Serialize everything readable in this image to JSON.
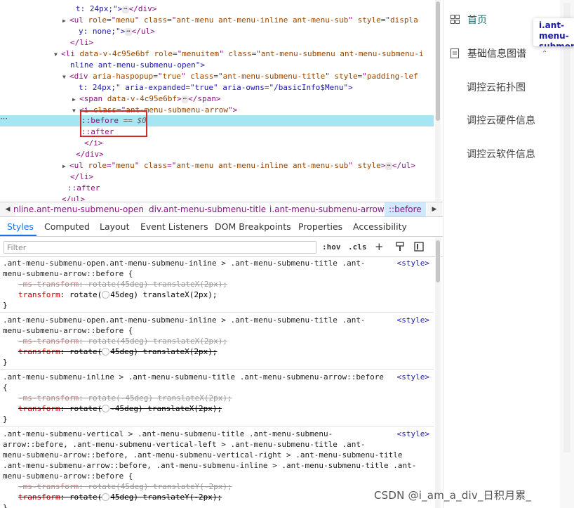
{
  "elements": {
    "lines": [
      {
        "pre": "      t: 24px;\">",
        "ell": true,
        "post": "</div>"
      },
      {
        "pre": "    <ul role=\"menu\" class=\"ant-menu ant-menu-inline ant-menu-sub\" style=\"displa"
      },
      {
        "pre": "      y: none;\">",
        "ell": true,
        "post": "</ul>"
      },
      {
        "pre": "    </li>"
      },
      {
        "pre": "  <li data-v-4c95e6bf role=\"menuitem\" class=\"ant-menu-submenu ant-menu-submenu-i"
      },
      {
        "pre": "    nline ant-menu-submenu-open\">"
      },
      {
        "pre": "    <div aria-haspopup=\"true\" class=\"ant-menu-submenu-title\" style=\"padding-lef"
      },
      {
        "pre": "      t: 24px;\" aria-expanded=\"true\" aria-owns=\"/basicInfo$Menu\">"
      },
      {
        "pre": "      <span data-v-4c95e6bf>",
        "ell": true,
        "post": "</span>"
      },
      {
        "pre": "      <i class=\"ant-menu-submenu-arrow\">"
      },
      {
        "pre": "          ::before",
        "eq": " == ",
        "dim": "$0"
      },
      {
        "pre": "          ::after"
      },
      {
        "pre": "        </i>"
      },
      {
        "pre": "      </div>"
      },
      {
        "pre": "    <ul role=\"menu\" class=\"ant-menu ant-menu-inline ant-menu-sub\" style>",
        "ell": true,
        "post": "</ul>"
      },
      {
        "pre": "    </li>"
      },
      {
        "pre": "    ::after"
      },
      {
        "pre": "  </ul>"
      }
    ]
  },
  "breadcrumb": {
    "items": [
      "nline.ant-menu-submenu-open",
      "div.ant-menu-submenu-title",
      "i.ant-menu-submenu-arrow",
      "::before"
    ]
  },
  "tabs": [
    "Styles",
    "Computed",
    "Layout",
    "Event Listeners",
    "DOM Breakpoints",
    "Properties",
    "Accessibility"
  ],
  "filter": {
    "placeholder": "Filter",
    "hov": ":hov",
    "cls": ".cls",
    "plus": "+"
  },
  "rules": [
    {
      "selector": ".ant-menu-submenu-open.ant-menu-submenu-inline > .ant-menu-submenu-title .ant-\nmenu-submenu-arrow::before {",
      "source": "<style>",
      "decls": [
        {
          "prop": "-ms-transform",
          "value": "rotate(45deg) translateX(2px)",
          "state": "faded"
        },
        {
          "prop": "transform",
          "value_pre": "rotate(",
          "angle": true,
          "value_post": "45deg) translateX(2px)",
          "state": "active"
        }
      ]
    },
    {
      "selector": ".ant-menu-submenu-open.ant-menu-submenu-inline > .ant-menu-submenu-title .ant-\nmenu-submenu-arrow::before {",
      "source": "<style>",
      "decls": [
        {
          "prop": "-ms-transform",
          "value": "rotate(45deg) translateX(2px)",
          "state": "faded"
        },
        {
          "prop": "transform",
          "value_pre": "rotate(",
          "angle": true,
          "value_post": "45deg) translateX(2px)",
          "state": "struck"
        }
      ]
    },
    {
      "selector": ".ant-menu-submenu-inline > .ant-menu-submenu-title .ant-menu-submenu-arrow::before\n{",
      "source": "<style>",
      "decls": [
        {
          "prop": "-ms-transform",
          "value": "rotate(-45deg) translateX(2px)",
          "state": "faded"
        },
        {
          "prop": "transform",
          "value_pre": "rotate(",
          "angle": true,
          "value_post": "-45deg) translateX(2px)",
          "state": "struck"
        }
      ]
    },
    {
      "selector": ".ant-menu-submenu-vertical > .ant-menu-submenu-title .ant-menu-submenu-\narrow::before, .ant-menu-submenu-vertical-left > .ant-menu-submenu-title .ant-\nmenu-submenu-arrow::before, .ant-menu-submenu-vertical-right > .ant-menu-submenu-title\n.ant-menu-submenu-arrow::before, .ant-menu-submenu-inline > .ant-menu-submenu-title .ant-\nmenu-submenu-arrow::before {",
      "source": "<style>",
      "decls": [
        {
          "prop": "-ms-transform",
          "value": "rotate(45deg) translateY(-2px)",
          "state": "faded"
        },
        {
          "prop": "transform",
          "value_pre": "rotate(",
          "angle": true,
          "value_post": "45deg) translateY(-2px)",
          "state": "struck"
        }
      ]
    },
    {
      "selector": ".ant-menu-submenu-vertical > .ant-menu-submenu-title .ant-menu-submenu-",
      "source": "<style>",
      "decls": []
    }
  ],
  "app": {
    "home": "首页",
    "basic_info": "基础信息图谱",
    "sub_items": [
      "调控云拓扑图",
      "调控云硬件信息",
      "调控云软件信息"
    ],
    "tooltip": "i.ant-menu-submenu-arrow"
  },
  "watermark": "CSDN @i_am_a_div_日积月累_",
  "colors": {
    "selected_row": "#a5e6f2",
    "highlight_box": "#d42a2a",
    "active_tab": "#1a73e8",
    "accent": "#1f6f6f"
  }
}
